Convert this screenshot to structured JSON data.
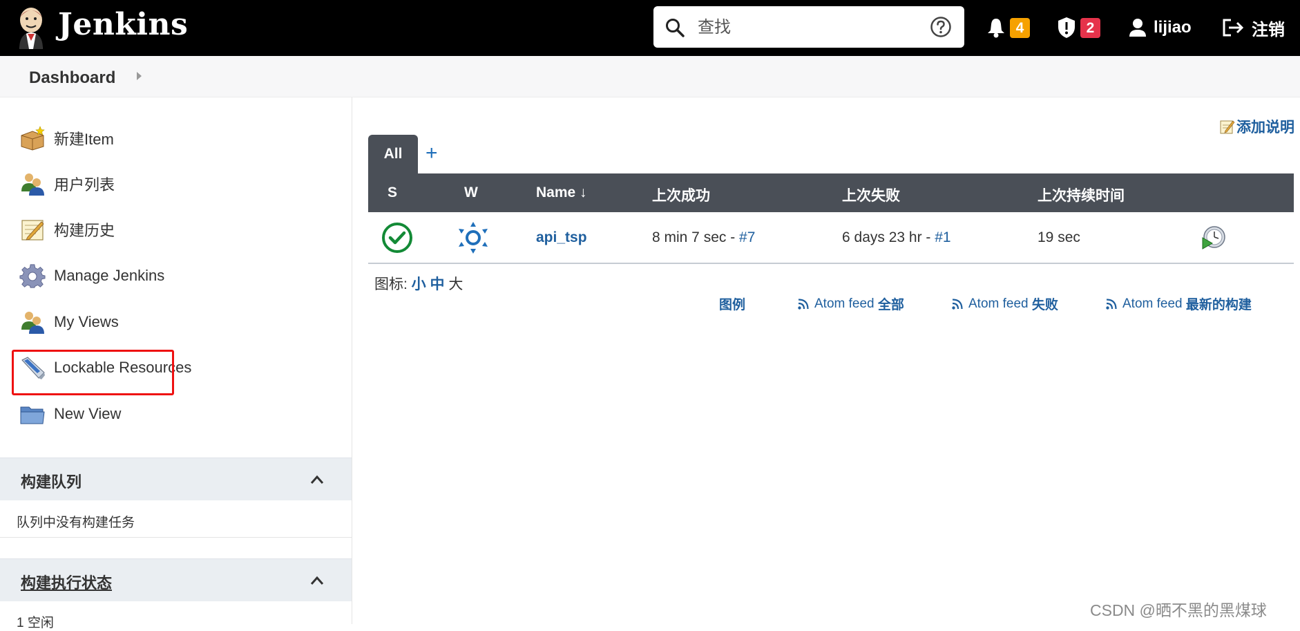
{
  "header": {
    "brand": "Jenkins",
    "search_placeholder": "查找",
    "notifications_count": "4",
    "security_count": "2",
    "user": "lijiao",
    "logout": "注销"
  },
  "breadcrumb": {
    "item": "Dashboard"
  },
  "sidebar": {
    "tasks": [
      {
        "label": "新建Item",
        "icon": "new-item-icon"
      },
      {
        "label": "用户列表",
        "icon": "users-icon"
      },
      {
        "label": "构建历史",
        "icon": "build-history-icon"
      },
      {
        "label": "Manage Jenkins",
        "icon": "gear-icon"
      },
      {
        "label": "My Views",
        "icon": "users-icon"
      },
      {
        "label": "Lockable Resources",
        "icon": "usb-drive-icon"
      },
      {
        "label": "New View",
        "icon": "folder-icon"
      }
    ],
    "queue": {
      "title": "构建队列",
      "empty": "队列中没有构建任务"
    },
    "executors": {
      "title": "构建执行状态",
      "item": "1 空闲"
    }
  },
  "main": {
    "add_description": "添加说明",
    "tabs": [
      {
        "label": "All"
      }
    ],
    "add_tab": "+",
    "columns": {
      "s": "S",
      "w": "W",
      "name": "Name ↓",
      "last_success": "上次成功",
      "last_failure": "上次失败",
      "last_duration": "上次持续时间"
    },
    "jobs": [
      {
        "name": "api_tsp",
        "last_success": "8 min 7 sec - ",
        "last_success_build": "#7",
        "last_failure": "6 days 23 hr - ",
        "last_failure_build": "#1",
        "last_duration": "19 sec"
      }
    ],
    "icon_size": {
      "label": "图标: ",
      "small": "小",
      "medium": "中",
      "large": "大"
    },
    "legend": "图例",
    "feeds": {
      "all_prefix": "Atom feed ",
      "all_suffix": "全部",
      "failed_prefix": "Atom feed ",
      "failed_suffix": "失败",
      "latest_prefix": "Atom feed ",
      "latest_suffix": "最新的构建"
    }
  },
  "watermark": "CSDN @晒不黑的黑煤球",
  "colors": {
    "header_bg": "#000000",
    "link": "#1f5f9e",
    "table_head": "#4a4f57",
    "success": "#138a36",
    "badge_orange": "#f6a100",
    "badge_red": "#e6334b"
  }
}
